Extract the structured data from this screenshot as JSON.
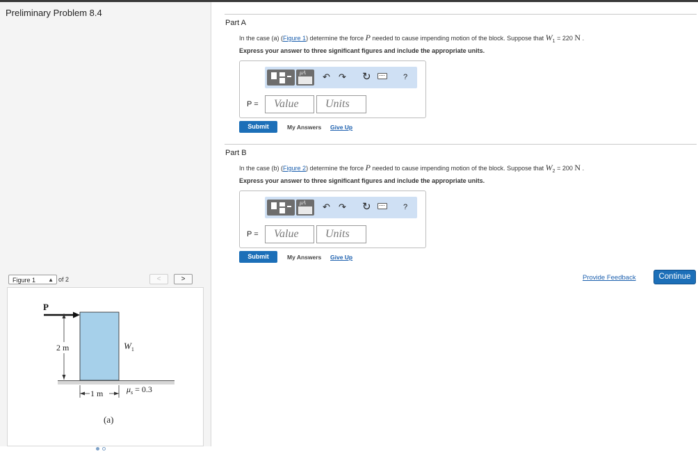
{
  "page": {
    "title": "Preliminary Problem 8.4"
  },
  "figure_nav": {
    "select_value": "Figure 1",
    "of_text": "of 2",
    "prev_label": "<",
    "next_label": ">"
  },
  "figure": {
    "force_label": "P",
    "height_label": "2 m",
    "weight_label": "W",
    "weight_sub": "1",
    "width_label": "1 m",
    "mu_label": "μ",
    "mu_sub": "s",
    "mu_value": "= 0.3",
    "caption": "(a)"
  },
  "parts": [
    {
      "title": "Part A",
      "text_1": "In the case (a) (",
      "figure_link": "Figure 1",
      "text_2": ") determine the force",
      "force_var": "P",
      "text_3": "needed to cause impending motion of the block. Suppose that",
      "weight_var": "W",
      "weight_sub": "1",
      "weight_value": "= 220",
      "unit": "N",
      "instruction": "Express your answer to three significant figures and include the appropriate units.",
      "answer_label": "P =",
      "value_placeholder": "Value",
      "units_placeholder": "Units",
      "submit_label": "Submit",
      "my_answers_label": "My Answers",
      "give_up_label": "Give Up"
    },
    {
      "title": "Part B",
      "text_1": "In the case (b) (",
      "figure_link": "Figure 2",
      "text_2": ") determine the force",
      "force_var": "P",
      "text_3": "needed to cause impending motion of the block. Suppose that",
      "weight_var": "W",
      "weight_sub": "2",
      "weight_value": "= 200",
      "unit": "N",
      "instruction": "Express your answer to three significant figures and include the appropriate units.",
      "answer_label": "P =",
      "value_placeholder": "Value",
      "units_placeholder": "Units",
      "submit_label": "Submit",
      "my_answers_label": "My Answers",
      "give_up_label": "Give Up"
    }
  ],
  "toolbar": {
    "template_icon": "templates-icon",
    "units_icon": "mu-units-icon",
    "undo_icon": "undo-icon",
    "redo_icon": "redo-icon",
    "reset_icon": "reset-icon",
    "keyboard_icon": "keyboard-icon",
    "help_label": "?",
    "mu_glyph": "μA"
  },
  "footer": {
    "feedback_label": "Provide Feedback",
    "continue_label": "Continue"
  },
  "colors": {
    "primary_button": "#1c6fb8",
    "link": "#1b5fae",
    "toolbar_bg": "#cfe0f4",
    "block_fill": "#a6d0ea"
  }
}
